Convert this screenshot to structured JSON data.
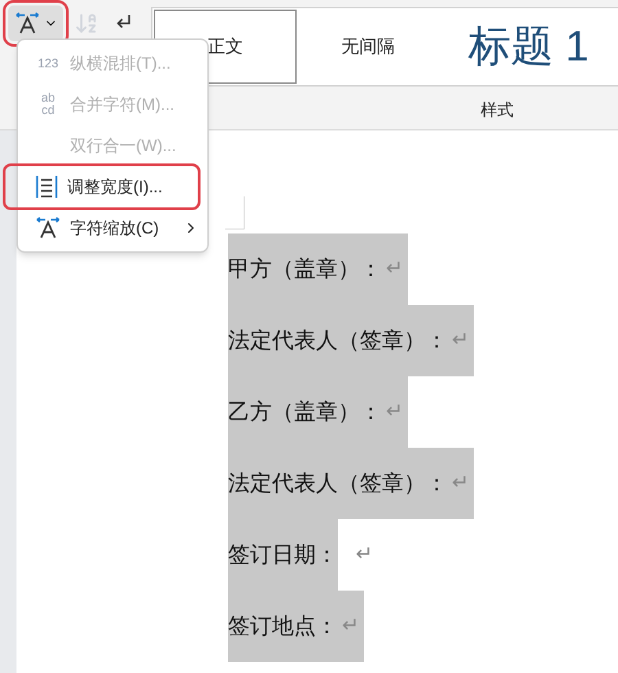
{
  "toolbar": {
    "text_button": {
      "annotated": true
    },
    "sort_disabled": true
  },
  "styles": {
    "items": [
      {
        "label": "正文",
        "selected": true,
        "kind": "normal"
      },
      {
        "label": "无间隔",
        "selected": false,
        "kind": "normal"
      },
      {
        "label": "标题 1",
        "selected": false,
        "kind": "heading"
      }
    ],
    "group_label": "样式"
  },
  "menu": {
    "items": [
      {
        "label": "纵横混排(T)...",
        "kind": "text",
        "icon_text": [
          "123"
        ],
        "disabled": true,
        "annotated": false,
        "submenu": false
      },
      {
        "label": "合并字符(M)...",
        "kind": "text",
        "icon_text": [
          "ab",
          "cd"
        ],
        "disabled": true,
        "annotated": false,
        "submenu": false
      },
      {
        "label": "双行合一(W)...",
        "kind": "plain",
        "disabled": true,
        "annotated": false,
        "submenu": false
      },
      {
        "label": "调整宽度(I)...",
        "kind": "width",
        "disabled": false,
        "annotated": true,
        "submenu": false
      },
      {
        "label": "字符缩放(C)",
        "kind": "scale",
        "disabled": false,
        "annotated": false,
        "submenu": true
      }
    ]
  },
  "document": {
    "paragraphs": [
      {
        "text": "甲方（盖章）：",
        "mark": "↵",
        "mark_selected": true
      },
      {
        "text": "法定代表人（签章）：",
        "mark": "↵",
        "mark_selected": true
      },
      {
        "text": "乙方（盖章）：",
        "mark": "↵",
        "mark_selected": true
      },
      {
        "text": "法定代表人（签章）：",
        "mark": "↵",
        "mark_selected": true
      },
      {
        "text": "签订日期：",
        "mark": "↵",
        "mark_selected": false
      },
      {
        "text": "签订地点：",
        "mark": "↵",
        "mark_selected": true
      }
    ]
  }
}
